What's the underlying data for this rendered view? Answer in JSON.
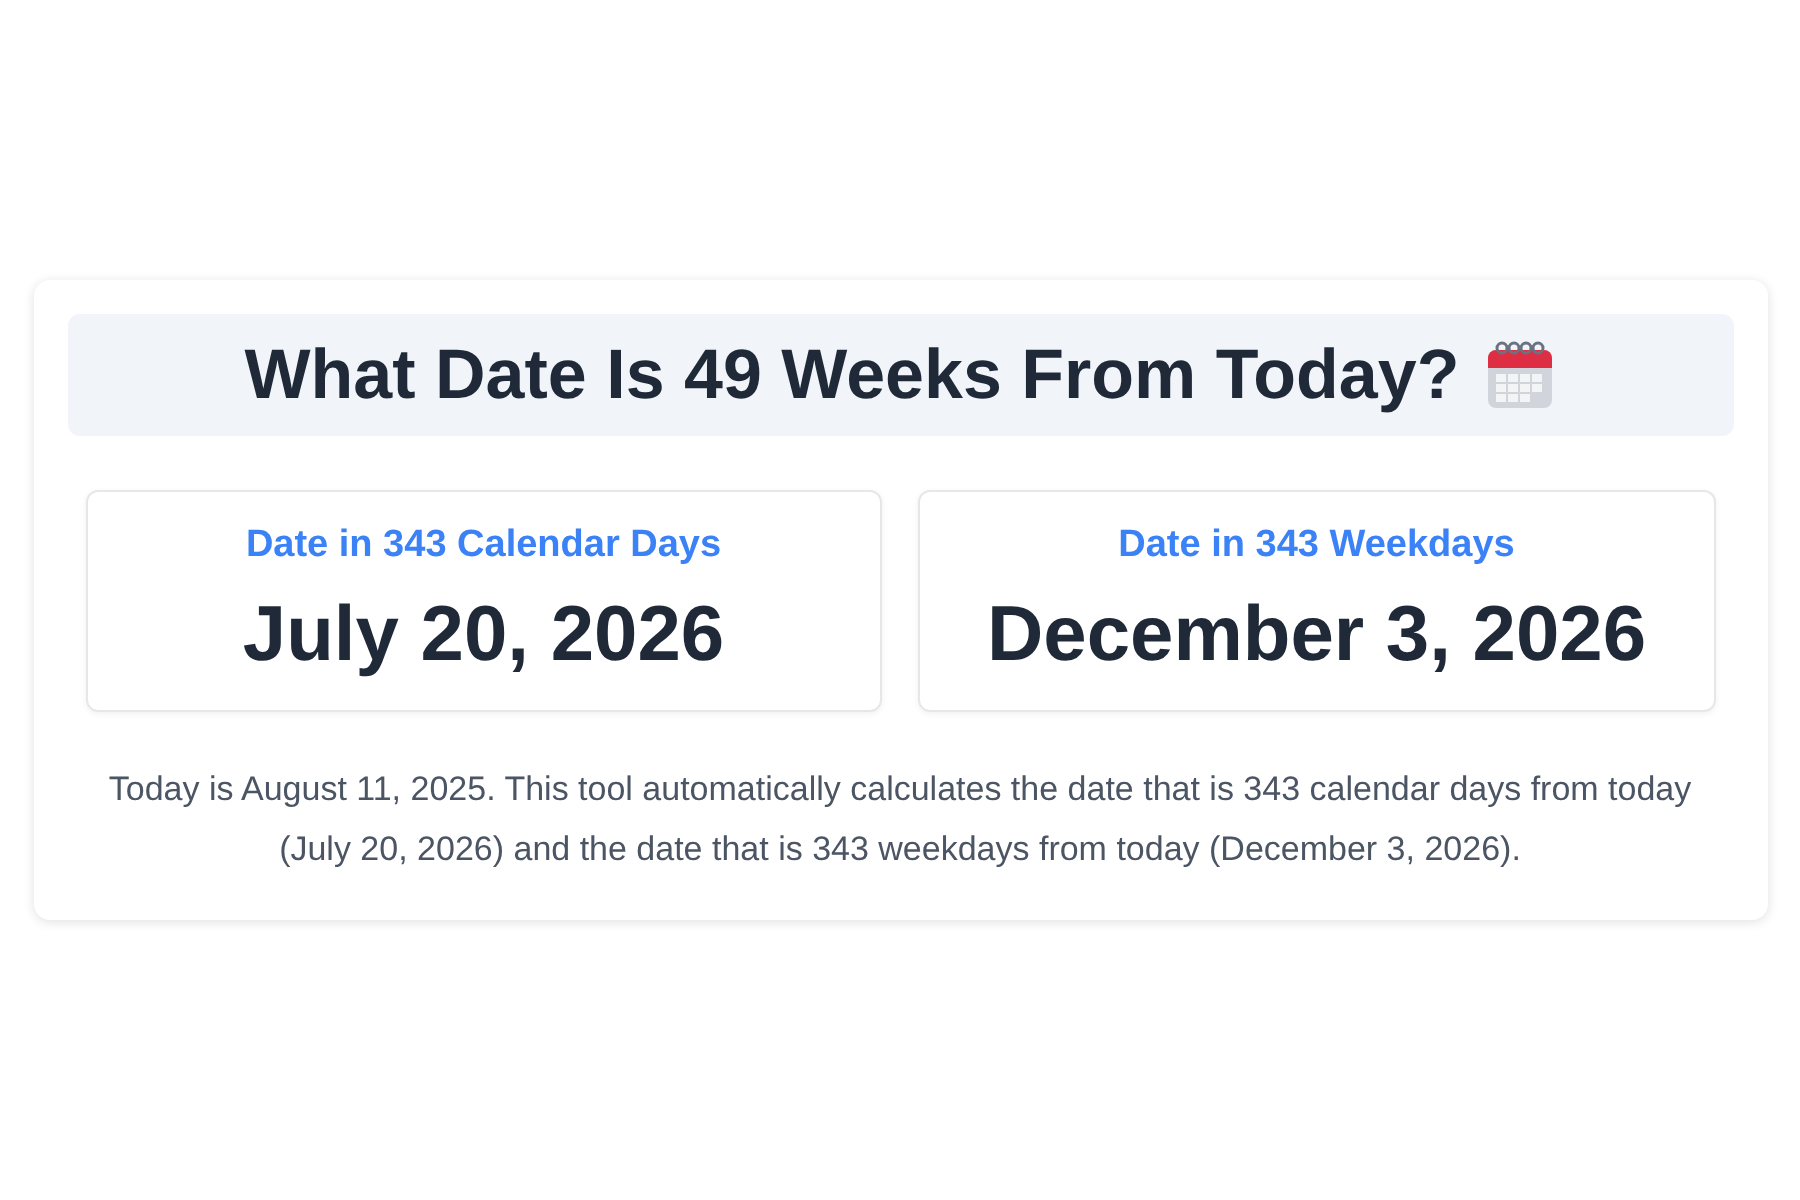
{
  "title": "What Date Is 49 Weeks From Today?",
  "results": [
    {
      "label": "Date in 343 Calendar Days",
      "value": "July 20, 2026"
    },
    {
      "label": "Date in 343 Weekdays",
      "value": "December 3, 2026"
    }
  ],
  "description": "Today is August 11, 2025. This tool automatically calculates the date that is 343 calendar days from today (July 20, 2026) and the date that is 343 weekdays from today (December 3, 2026)."
}
